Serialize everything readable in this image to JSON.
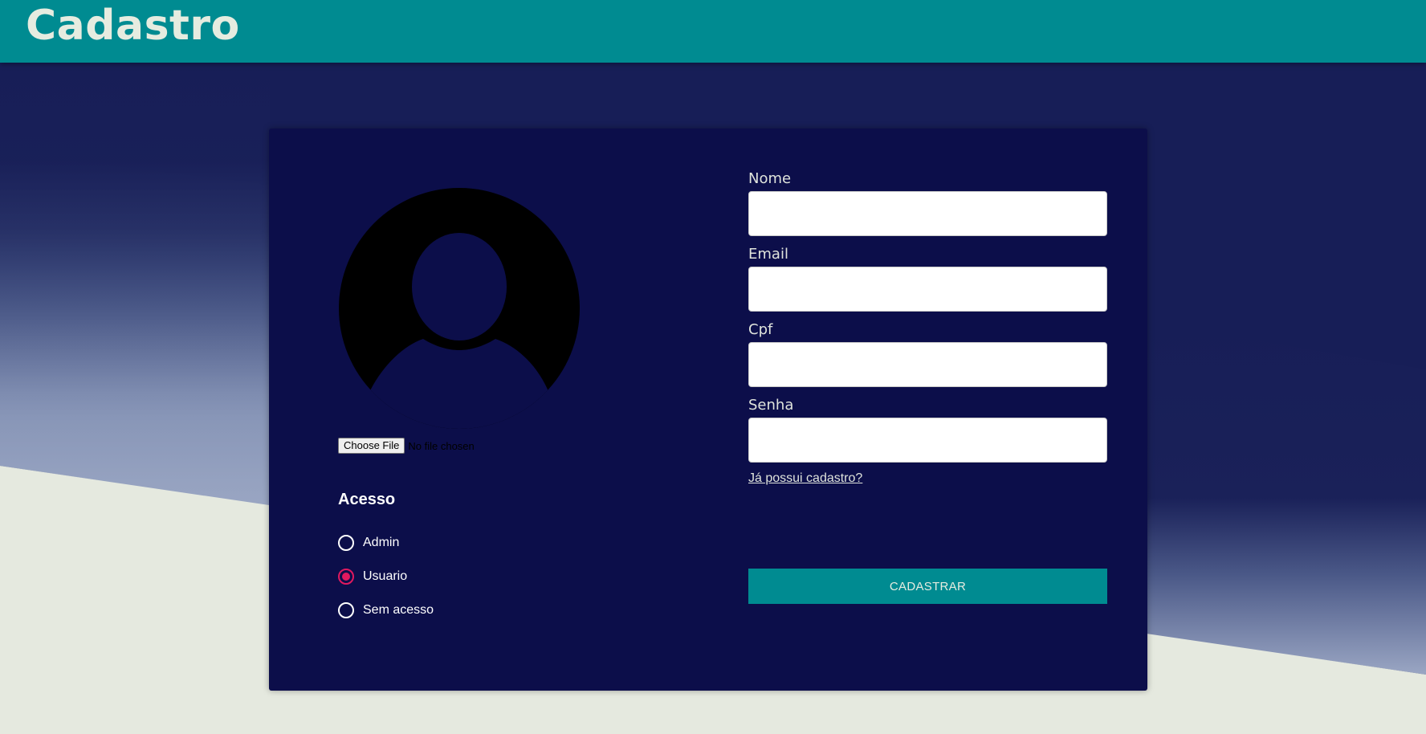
{
  "header": {
    "title": "Cadastro"
  },
  "colors": {
    "header_bg": "#008b91",
    "card_bg": "#0c0e4a",
    "page_dark": "#171e57",
    "page_light": "#e5e9df",
    "accent_radio": "#e0195f",
    "submit_bg": "#008b91"
  },
  "avatar": {
    "icon": "user-avatar-icon"
  },
  "file_input": {
    "button_label": "Choose File",
    "status": "No file chosen"
  },
  "access": {
    "title": "Acesso",
    "options": [
      {
        "label": "Admin",
        "checked": false
      },
      {
        "label": "Usuario",
        "checked": true
      },
      {
        "label": "Sem acesso",
        "checked": false
      }
    ]
  },
  "form": {
    "fields": [
      {
        "label": "Nome",
        "value": ""
      },
      {
        "label": "Email",
        "value": ""
      },
      {
        "label": "Cpf",
        "value": ""
      },
      {
        "label": "Senha",
        "value": ""
      }
    ],
    "login_link": "Já possui cadastro?",
    "submit_label": "CADASTRAR"
  }
}
